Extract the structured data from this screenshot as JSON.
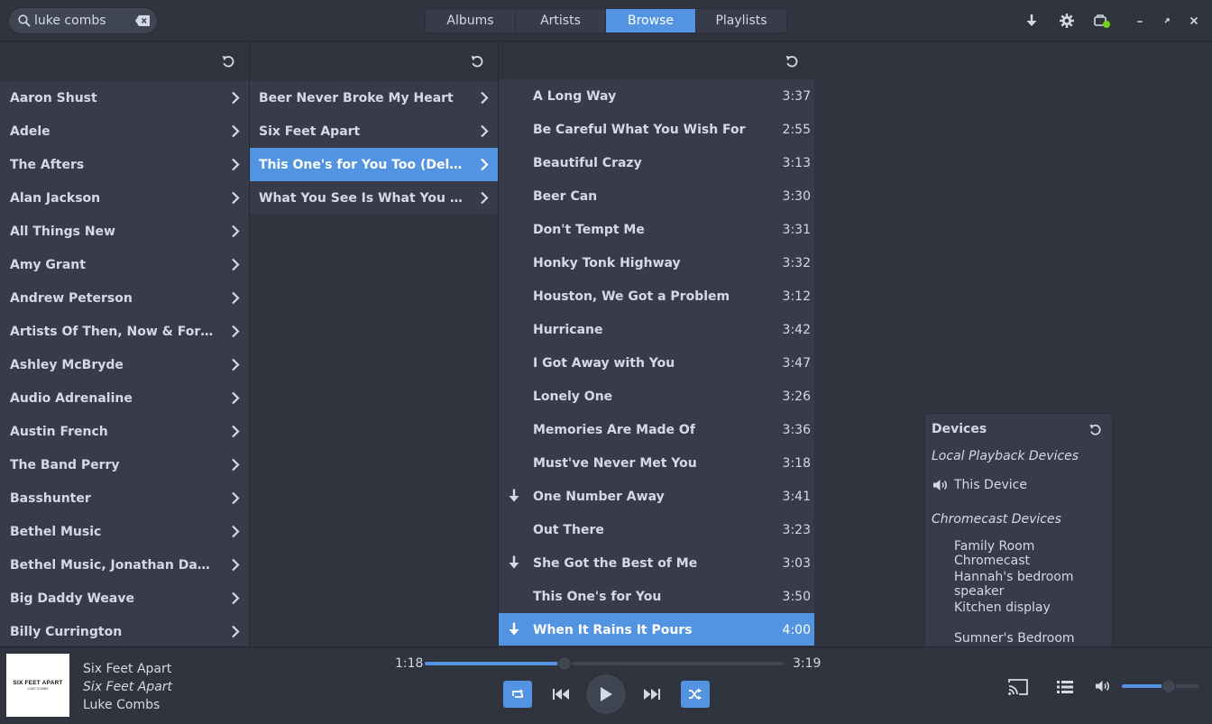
{
  "search": {
    "value": "luke combs"
  },
  "tabs": [
    {
      "label": "Albums"
    },
    {
      "label": "Artists"
    },
    {
      "label": "Browse"
    },
    {
      "label": "Playlists"
    }
  ],
  "active_tab": "Browse",
  "header_icons": [
    "download-icon",
    "gear-icon",
    "sync-status-icon",
    "minimize-icon",
    "restore-icon",
    "close-icon"
  ],
  "artists": [
    "Aaron Shust",
    "Adele",
    "The Afters",
    "Alan Jackson",
    "All Things New",
    "Amy Grant",
    "Andrew Peterson",
    "Artists Of Then, Now & Forever",
    "Ashley McBryde",
    "Audio Adrenaline",
    "Austin French",
    "The Band Perry",
    "Basshunter",
    "Bethel Music",
    "Bethel Music, Jonathan David & M…",
    "Big Daddy Weave",
    "Billy Currington"
  ],
  "albums": [
    {
      "label": "Beer Never Broke My Heart",
      "selected": false
    },
    {
      "label": "Six Feet Apart",
      "selected": false
    },
    {
      "label": "This One's for You Too (Deluxe Ed…",
      "selected": true
    },
    {
      "label": "What You See Is What You Get",
      "selected": false
    }
  ],
  "tracks": [
    {
      "title": "A Long Way",
      "duration": "3:37",
      "downloaded": false,
      "selected": false
    },
    {
      "title": "Be Careful What You Wish For",
      "duration": "2:55",
      "downloaded": false,
      "selected": false
    },
    {
      "title": "Beautiful Crazy",
      "duration": "3:13",
      "downloaded": false,
      "selected": false
    },
    {
      "title": "Beer Can",
      "duration": "3:30",
      "downloaded": false,
      "selected": false
    },
    {
      "title": "Don't Tempt Me",
      "duration": "3:31",
      "downloaded": false,
      "selected": false
    },
    {
      "title": "Honky Tonk Highway",
      "duration": "3:32",
      "downloaded": false,
      "selected": false
    },
    {
      "title": "Houston, We Got a Problem",
      "duration": "3:12",
      "downloaded": false,
      "selected": false
    },
    {
      "title": "Hurricane",
      "duration": "3:42",
      "downloaded": false,
      "selected": false
    },
    {
      "title": "I Got Away with You",
      "duration": "3:47",
      "downloaded": false,
      "selected": false
    },
    {
      "title": "Lonely One",
      "duration": "3:26",
      "downloaded": false,
      "selected": false
    },
    {
      "title": "Memories Are Made Of",
      "duration": "3:36",
      "downloaded": false,
      "selected": false
    },
    {
      "title": "Must've Never Met You",
      "duration": "3:18",
      "downloaded": false,
      "selected": false
    },
    {
      "title": "One Number Away",
      "duration": "3:41",
      "downloaded": true,
      "selected": false
    },
    {
      "title": "Out There",
      "duration": "3:23",
      "downloaded": false,
      "selected": false
    },
    {
      "title": "She Got the Best of Me",
      "duration": "3:03",
      "downloaded": true,
      "selected": false
    },
    {
      "title": "This One's for You",
      "duration": "3:50",
      "downloaded": false,
      "selected": false
    },
    {
      "title": "When It Rains It Pours",
      "duration": "4:00",
      "downloaded": true,
      "selected": true
    }
  ],
  "devices": {
    "title": "Devices",
    "local_heading": "Local Playback Devices",
    "local": [
      "This Device"
    ],
    "chromecast_heading": "Chromecast Devices",
    "chromecast": [
      "Family Room Chromecast",
      "Hannah's bedroom speaker",
      "Kitchen display",
      "Sumner's Bedroom"
    ]
  },
  "now_playing": {
    "title": "Six Feet Apart",
    "album": "Six Feet Apart",
    "artist": "Luke Combs",
    "art_title": "SIX FEET APART",
    "art_subtitle": "LUKE COMBS",
    "elapsed": "1:18",
    "total": "3:19",
    "progress": 0.39,
    "repeat_on": true,
    "shuffle_on": true,
    "volume": 0.6
  },
  "colors": {
    "accent": "#5294e2",
    "background": "#2f343f",
    "list_bg": "#383c4a",
    "text": "#d3dae3"
  }
}
